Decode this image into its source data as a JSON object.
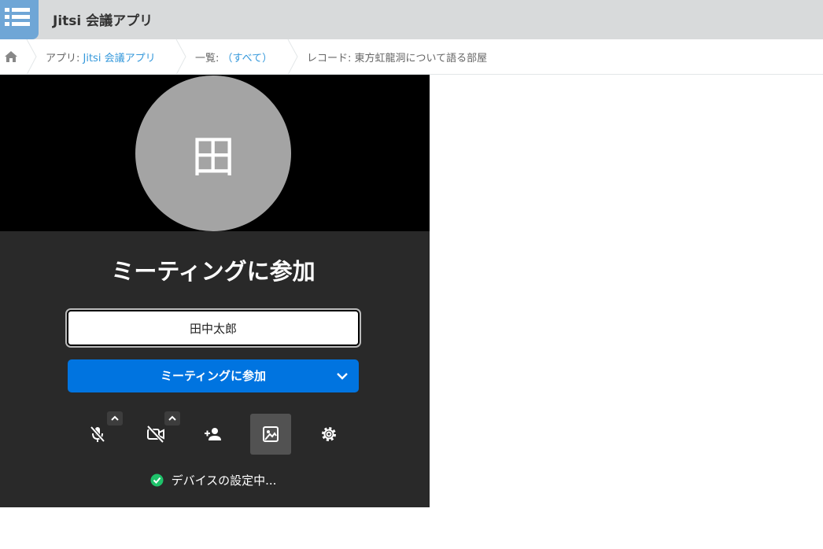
{
  "header": {
    "title": "Jitsi 会議アプリ",
    "icon": "list-icon"
  },
  "breadcrumb": {
    "app_prefix": "アプリ: ",
    "app_name": "Jitsi 会議アプリ",
    "list_prefix": "一覧: ",
    "list_name": "（すべて）",
    "record": "レコード: 東方虹龍洞について語る部屋"
  },
  "jitsi": {
    "avatar_initial": "田",
    "join_title": "ミーティングに参加",
    "name_value": "田中太郎",
    "join_button": "ミーティングに参加",
    "status_text": "デバイスの設定中...",
    "toolbar": [
      "mic-off-icon",
      "camera-off-icon",
      "invite-icon",
      "background-icon",
      "settings-icon"
    ],
    "accent_color": "#0074e0",
    "status_color": "#1ec26a"
  }
}
